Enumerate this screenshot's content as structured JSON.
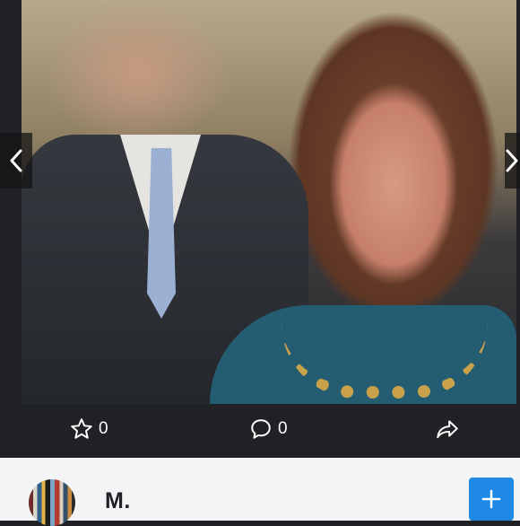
{
  "post": {
    "like_count": "0",
    "comment_count": "0"
  },
  "user": {
    "name": "M."
  },
  "icons": {
    "prev": "chevron-left-icon",
    "next": "chevron-right-icon",
    "like": "star-icon",
    "comment": "comment-bubble-icon",
    "share": "share-arrow-icon",
    "follow": "plus-icon"
  },
  "colors": {
    "background": "#1f2125",
    "user_bar": "#f3f4f6",
    "accent": "#1e88e5"
  }
}
